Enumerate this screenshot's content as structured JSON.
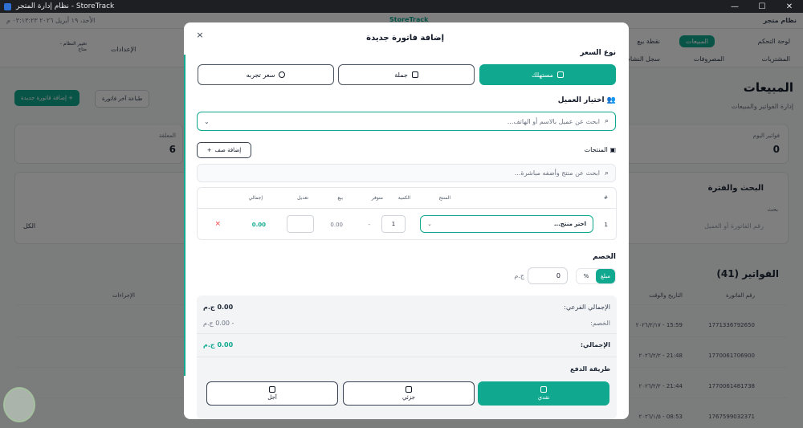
{
  "window": {
    "title": "نظام إدارة المتجر - StoreTrack"
  },
  "bg": {
    "store_name": "نظام متجر",
    "brand": "StoreTrack",
    "datetime": "الأحد، ١٩ أبريل ٢٠٢٦ ٠٣:١٣:٢٣ م",
    "nav": {
      "dashboard": "لوحة التحكم",
      "sales": "المبيعات",
      "pos": "نقطة بيع",
      "purchases": "المشتريات",
      "expenses": "المصروفات",
      "activity": "سجل النشاط",
      "settings": "الإعدادات",
      "change_system": "تغيير النظام - متاح"
    },
    "heading": "المبيعات",
    "subheading": "إدارة الفواتير والمبيعات",
    "btn_new_invoice": "+ إضافة فاتورة جديدة",
    "btn_print_last": "طباعة آخر فاتورة",
    "stat_today_label": "فواتير اليوم",
    "stat_today_value": "0",
    "stat_count_label": "المعلقة",
    "stat_count_value": "6",
    "search_title": "البحث والفترة",
    "search_placeholder": "رقم الفاتورة أو العميل",
    "search_sub": "بحث",
    "filter_all": "الكل",
    "invoices_title": "الفواتير (41)",
    "table_headers": [
      "رقم الفاتورة",
      "التاريخ والوقت",
      "الإجراءات"
    ],
    "rows": [
      {
        "id": "1771336792650",
        "time": "15:59 - ٢٠٢٦/٢/١٧"
      },
      {
        "id": "1770061706900",
        "time": "21:48 - ٢٠٢٦/٢/٢"
      },
      {
        "id": "1770061481738",
        "time": "21:44 - ٢٠٢٦/٢/٢"
      },
      {
        "id": "1767599032371",
        "time": "08:53 - ٢٠٢٦/١/٥"
      }
    ]
  },
  "modal": {
    "title": "إضافة فاتورة جديدة",
    "close": "×",
    "price_type_label": "نوع السعر",
    "price_types": [
      {
        "label": "مستهلك",
        "icon": "tag-icon",
        "active": true
      },
      {
        "label": "جملة",
        "icon": "store-icon",
        "active": false
      },
      {
        "label": "سعر تجربه",
        "icon": "clock-icon",
        "active": false
      }
    ],
    "customer_label": "اختيار العميل",
    "customer_placeholder": "ابحث عن عميل بالاسم أو الهاتف...",
    "products_label": "المنتجات",
    "add_row_label": "إضافة صف",
    "product_search_placeholder": "ابحث عن منتج وأضفه مباشرة...",
    "table": {
      "headers": {
        "num": "#",
        "product": "المنتج",
        "qty": "الكمية",
        "available": "متوفر",
        "sell": "بيع",
        "edit": "تعديل",
        "total": "إجمالي"
      },
      "row": {
        "num": "1",
        "product_placeholder": "اختر منتج...",
        "qty": "1",
        "available": "-",
        "sell": "0.00",
        "edit": "",
        "total": "0.00",
        "delete": "×"
      }
    },
    "discount": {
      "label": "الخصم",
      "modes": {
        "amount": "مبلغ",
        "percent": "%"
      },
      "value": "0",
      "currency": "ج.م"
    },
    "summary": {
      "subtotal_label": "الإجمالي الفرعي:",
      "subtotal_value": "0.00 ج.م",
      "discount_label": "الخصم:",
      "discount_value": "- 0.00 ج.م",
      "total_label": "الإجمالي:",
      "total_value": "0.00 ج.م"
    },
    "payment": {
      "label": "طريقة الدفع",
      "methods": [
        {
          "label": "نقدي",
          "icon": "cash-icon",
          "active": true
        },
        {
          "label": "جزئي",
          "icon": "split-icon",
          "active": false
        },
        {
          "label": "آجل",
          "icon": "wallet-icon",
          "active": false
        }
      ]
    }
  },
  "colors": {
    "accent": "#10a98f",
    "overlay": "#000000"
  }
}
